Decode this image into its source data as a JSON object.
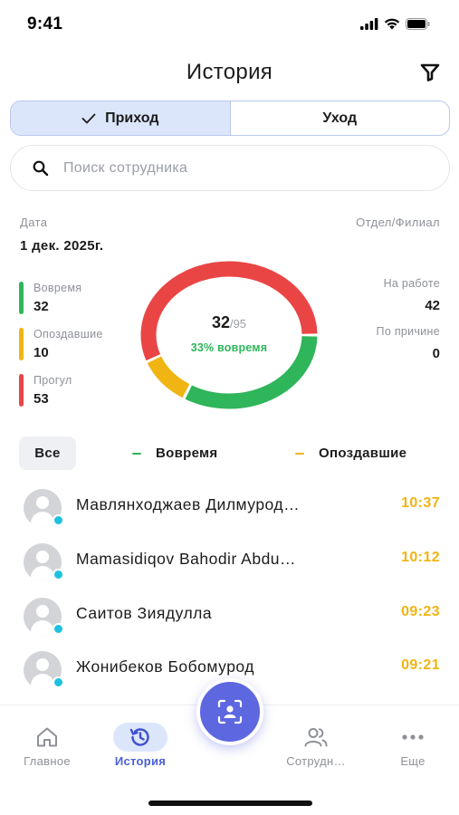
{
  "status_bar": {
    "time": "9:41"
  },
  "header": {
    "title": "История",
    "filter_icon": "filter-icon"
  },
  "segments": [
    {
      "label": "Приход",
      "active": true
    },
    {
      "label": "Уход",
      "active": false
    }
  ],
  "search": {
    "placeholder": "Поиск сотрудника",
    "value": ""
  },
  "date": {
    "label": "Дата",
    "value": "1 дек. 2025г."
  },
  "department": {
    "label": "Отдел/Филиал"
  },
  "stats": [
    {
      "label": "Вовремя",
      "value": "32",
      "color": "#2fb55a"
    },
    {
      "label": "Опоздавшие",
      "value": "10",
      "color": "#f0b413"
    },
    {
      "label": "Прогул",
      "value": "53",
      "color": "#ea4545"
    }
  ],
  "right_stats": [
    {
      "label": "На работе",
      "value": "42"
    },
    {
      "label": "По причине",
      "value": "0"
    }
  ],
  "donut": {
    "count": "32",
    "total": "/95",
    "percent_text": "33% вовремя",
    "segments": [
      {
        "name": "Вовремя",
        "value": 32,
        "color": "#2fb55a"
      },
      {
        "name": "Опоздавшие",
        "value": 10,
        "color": "#f0b413"
      },
      {
        "name": "Прогул",
        "value": 53,
        "color": "#ea4545"
      }
    ]
  },
  "filters": {
    "all": "Все",
    "ontime": {
      "label": "Вовремя",
      "color": "#2fb55a"
    },
    "late": {
      "label": "Опоздавшие",
      "color": "#f0b413"
    }
  },
  "employees": [
    {
      "name": "Мавлянходжаев Дилмурод…",
      "time": "10:37"
    },
    {
      "name": "Mamasidiqov Bahodir Abdu…",
      "time": "10:12"
    },
    {
      "name": "Саитов Зиядулла",
      "time": "09:23"
    },
    {
      "name": "Жонибеков Бобомурод",
      "time": "09:21"
    }
  ],
  "nav": [
    {
      "label": "Главное",
      "icon": "home-icon",
      "active": false
    },
    {
      "label": "История",
      "icon": "history-icon",
      "active": true
    },
    {
      "label": "Сотрудн…",
      "icon": "users-icon",
      "active": false
    },
    {
      "label": "Еще",
      "icon": "more-icon",
      "active": false
    }
  ],
  "fab": {
    "icon": "face-scan-icon"
  },
  "colors": {
    "accent": "#5d67e0",
    "ontime": "#2fb55a",
    "late": "#f0b413",
    "absent": "#ea4545"
  }
}
